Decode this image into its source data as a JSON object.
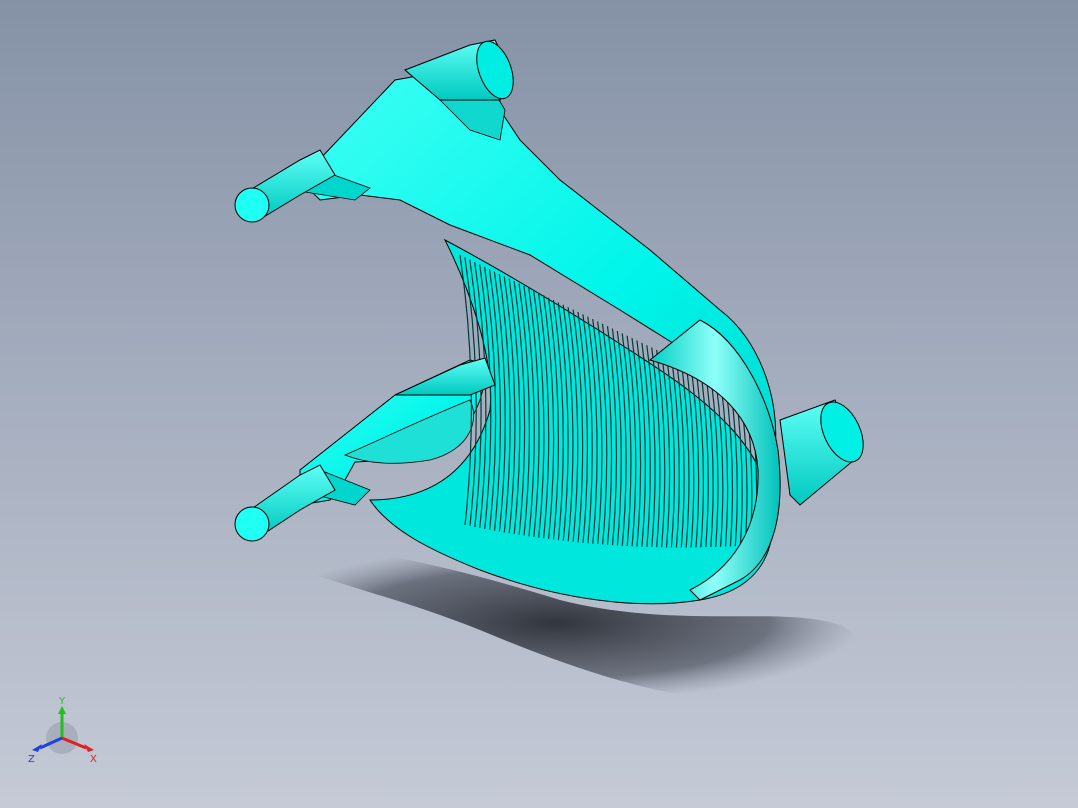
{
  "viewport": {
    "background_top": "#8592a6",
    "background_bottom": "#c5cad6"
  },
  "model": {
    "body_color": "#00f5ea",
    "shade_color": "#00c9c0",
    "edge_color": "#000000"
  },
  "triad": {
    "x_label": "X",
    "y_label": "Y",
    "z_label": "Z",
    "x_color": "#e02020",
    "y_color": "#20c020",
    "z_color": "#2040e0"
  }
}
